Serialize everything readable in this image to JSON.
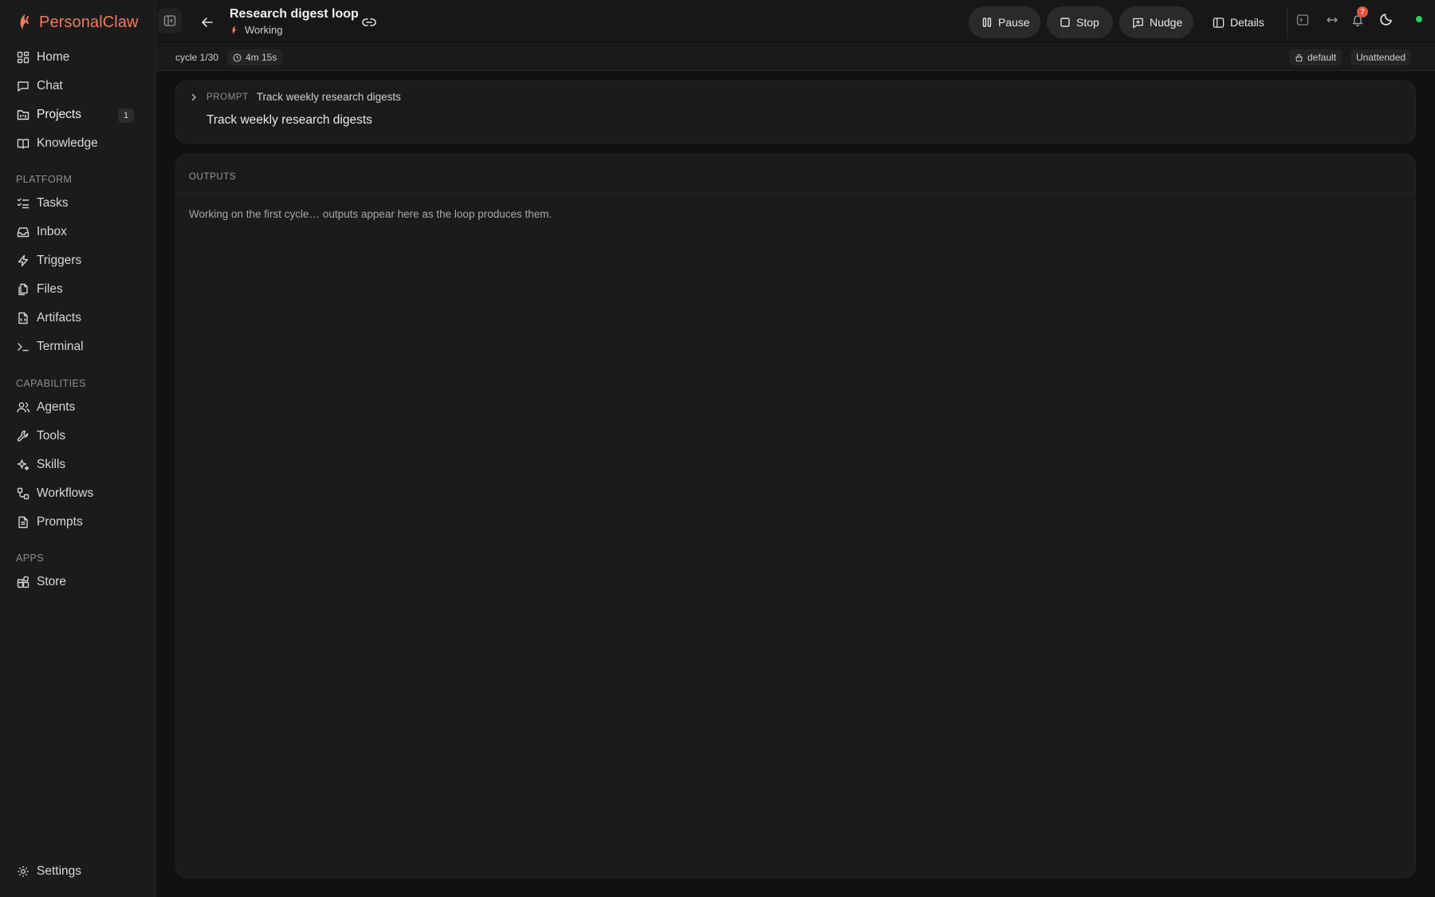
{
  "app": {
    "name": "PersonalClaw",
    "accent": "#ef7a5b"
  },
  "sidebar": {
    "primary": [
      {
        "label": "Home",
        "icon": "dashboard-icon"
      },
      {
        "label": "Chat",
        "icon": "chat-bubble-icon"
      },
      {
        "label": "Projects",
        "icon": "folder-kanban-icon",
        "badge": "1",
        "active": true
      },
      {
        "label": "Knowledge",
        "icon": "book-open-icon"
      }
    ],
    "platform_label": "PLATFORM",
    "platform": [
      {
        "label": "Tasks",
        "icon": "list-checks-icon"
      },
      {
        "label": "Inbox",
        "icon": "inbox-icon"
      },
      {
        "label": "Triggers",
        "icon": "lightning-icon"
      },
      {
        "label": "Files",
        "icon": "files-icon"
      },
      {
        "label": "Artifacts",
        "icon": "file-code-icon"
      },
      {
        "label": "Terminal",
        "icon": "terminal-icon"
      }
    ],
    "capabilities_label": "CAPABILITIES",
    "capabilities": [
      {
        "label": "Agents",
        "icon": "users-icon"
      },
      {
        "label": "Tools",
        "icon": "wrench-icon"
      },
      {
        "label": "Skills",
        "icon": "sparkles-icon"
      },
      {
        "label": "Workflows",
        "icon": "workflow-icon"
      },
      {
        "label": "Prompts",
        "icon": "document-icon"
      }
    ],
    "apps_label": "APPS",
    "apps": [
      {
        "label": "Store",
        "icon": "blocks-icon"
      }
    ],
    "settings": {
      "label": "Settings",
      "icon": "gear-icon"
    }
  },
  "header": {
    "title": "Research digest loop",
    "status": "Working",
    "actions": {
      "pause": "Pause",
      "stop": "Stop",
      "nudge": "Nudge",
      "details": "Details"
    },
    "notification_count": "7",
    "online_color": "#2ccb64"
  },
  "subbar": {
    "cycle": "cycle 1/30",
    "elapsed": "4m 15s",
    "profile": "default",
    "mode": "Unattended"
  },
  "prompt": {
    "label": "PROMPT",
    "summary": "Track weekly research digests",
    "body": "Track weekly research digests"
  },
  "outputs": {
    "label": "OUTPUTS",
    "empty_message": "Working on the first cycle… outputs appear here as the loop produces them."
  }
}
